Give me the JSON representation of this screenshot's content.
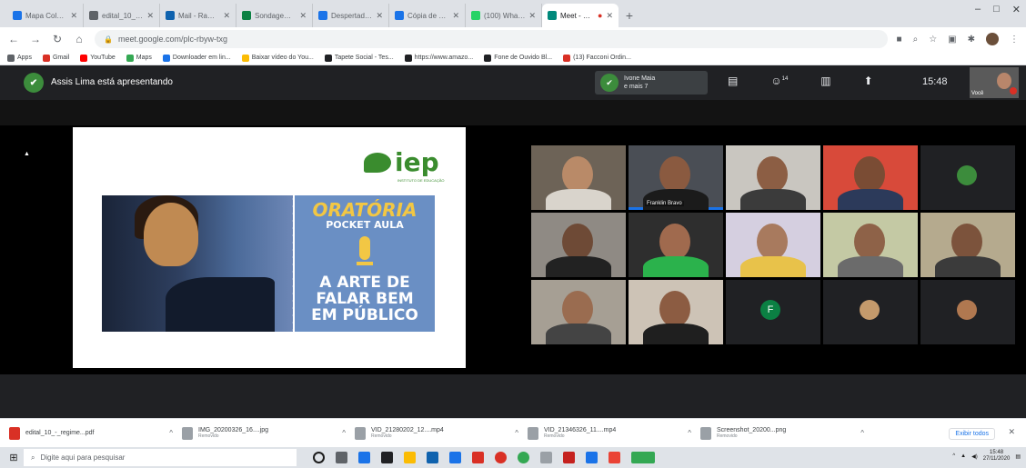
{
  "browser": {
    "tabs": [
      {
        "label": "Mapa Colaborativo",
        "color": "#1a73e8"
      },
      {
        "label": "edital_10_...pdf",
        "color": "#5f6368"
      },
      {
        "label": "Mail - Ramos...",
        "color": "#0f62ae"
      },
      {
        "label": "Sondagem 02...",
        "color": "#0b8043"
      },
      {
        "label": "Despertador...",
        "color": "#1a73e8"
      },
      {
        "label": "Cópia de Boa...",
        "color": "#1a73e8"
      },
      {
        "label": "(100) WhatsApp",
        "color": "#25d366"
      },
      {
        "label": "Meet - plc...",
        "color": "#00897b",
        "active": true
      }
    ],
    "new_tab": "+",
    "window_controls": {
      "minimize": "–",
      "maximize": "□",
      "close": "✕"
    },
    "url": "meet.google.com/plc-rbyw-txg",
    "bookmarks": [
      {
        "label": "Apps",
        "color": "#5f6368"
      },
      {
        "label": "Gmail",
        "color": "#d93025"
      },
      {
        "label": "YouTube",
        "color": "#ff0000"
      },
      {
        "label": "Maps",
        "color": "#34a853"
      },
      {
        "label": "Downloader em lin...",
        "color": "#1a73e8"
      },
      {
        "label": "Baixar vídeo do You...",
        "color": "#fbbc04"
      },
      {
        "label": "Tapete Social - Tes...",
        "color": "#202124"
      },
      {
        "label": "https://www.amazo...",
        "color": "#202124"
      },
      {
        "label": "Fone de Ouvido Bl...",
        "color": "#202124"
      },
      {
        "label": "(13) Facconi Ordin...",
        "color": "#d93025"
      }
    ]
  },
  "meet": {
    "presenter_text": "Assis Lima está apresentando",
    "pinned_line1": "Ivone Maia",
    "pinned_line2": "e mais 7",
    "participant_count": "14",
    "clock": "15:48",
    "self_label": "Você",
    "slide": {
      "logo": "iep",
      "logo_sub": "INSTITUTO DE EDUCAÇÃO",
      "title": "ORATÓRIA",
      "subtitle": "POCKET AULA",
      "main_line1": "A ARTE DE",
      "main_line2": "FALAR BEM",
      "main_line3": "EM PÚBLICO"
    },
    "speaker_name": "Franklin Bravo",
    "letter_avatar": "F"
  },
  "downloads": {
    "items": [
      {
        "name": "edital_10_-_regime...pdf",
        "sub": "",
        "icon": "pdf"
      },
      {
        "name": "IMG_20200326_16....jpg",
        "sub": "Removido",
        "icon": "img"
      },
      {
        "name": "VID_21280202_12....mp4",
        "sub": "Removido",
        "icon": "img"
      },
      {
        "name": "VID_21346326_11....mp4",
        "sub": "Removido",
        "icon": "img"
      },
      {
        "name": "Screenshot_20200...png",
        "sub": "Removido",
        "icon": "img"
      }
    ],
    "show_all": "Exibir todos",
    "close": "✕"
  },
  "taskbar": {
    "search_placeholder": "Digite aqui para pesquisar",
    "time": "15:48",
    "date": "27/11/2020"
  }
}
